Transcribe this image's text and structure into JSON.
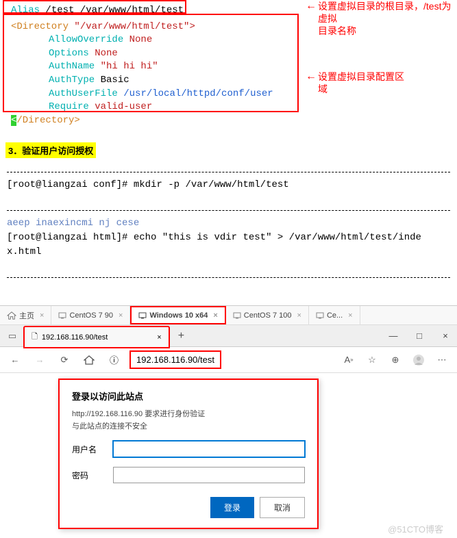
{
  "config": {
    "alias_keyword": "Alias",
    "alias_path1": "/test",
    "alias_path2": "/var/www/html/test",
    "directory_open": "<Directory",
    "directory_path": "\"/var/www/html/test\">",
    "directives": [
      {
        "key": "AllowOverride",
        "val": "None",
        "val_class": "red-text"
      },
      {
        "key": "Options",
        "val": "None",
        "val_class": "red-text"
      },
      {
        "key": "AuthName",
        "val": "\"hi hi hi\"",
        "val_class": "red-text"
      },
      {
        "key": "AuthType",
        "val": "Basic",
        "val_class": "black-text"
      },
      {
        "key": "AuthUserFile",
        "val": "/usr/local/httpd/conf/user",
        "val_class": "blue-text"
      },
      {
        "key": "Require",
        "val": "valid-user",
        "val_class": "red-text"
      }
    ],
    "directory_close_slash": "<",
    "directory_close": "/Directory>"
  },
  "annotations": {
    "arrow_left": "←",
    "line1a": "设置虚拟目录的根目录，/test为虚拟",
    "line1b": "目录名称",
    "line2a": "设置虚拟目录配置区",
    "line2b": "域"
  },
  "section3": "3．验证用户访问授权",
  "terminal": {
    "prompt1": "[root@liangzai conf]# ",
    "cmd1": "mkdir -p /var/www/html/test",
    "fade_line": "aeep  inaexincmi  nj  cese",
    "prompt2": "[root@liangzai html]# ",
    "cmd2a": "echo \"this is vdir test\" > /var/www/html/test/inde",
    "cmd2b": "x.html"
  },
  "vm_tabs": {
    "home": "主页",
    "t1": "CentOS 7 90",
    "t2": "Windows 10 x64",
    "t3": "CentOS 7 100",
    "t4": "Ce..."
  },
  "browser": {
    "tab_title": "192.168.116.90/test",
    "tab_close": "×",
    "new_tab": "+",
    "url": "192.168.116.90/test",
    "info_icon": "ⓘ",
    "min": "—",
    "max": "□",
    "close": "×"
  },
  "dialog": {
    "title": "登录以访问此站点",
    "sub1": "http://192.168.116.90 要求进行身份验证",
    "sub2": "与此站点的连接不安全",
    "user_label": "用户名",
    "pass_label": "密码",
    "login": "登录",
    "cancel": "取消"
  },
  "watermark": "@51CTO博客"
}
